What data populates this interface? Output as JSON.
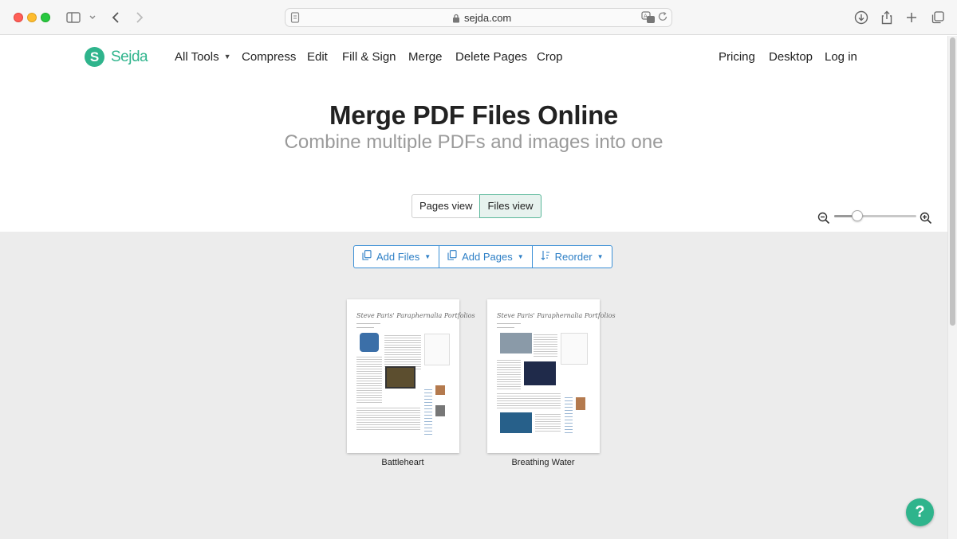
{
  "browser": {
    "url": "sejda.com",
    "icons": [
      "sidebar-icon",
      "chevron-down-icon",
      "back-icon",
      "forward-icon",
      "page-icon",
      "lock-icon",
      "translate-icon",
      "reload-icon",
      "download-icon",
      "share-icon",
      "new-tab-icon",
      "tabs-overview-icon"
    ]
  },
  "nav": {
    "logo_letter": "S",
    "logo_text": "Sejda",
    "left_links": [
      "All Tools",
      "Compress",
      "Edit",
      "Fill & Sign",
      "Merge",
      "Delete Pages",
      "Crop"
    ],
    "right_links": [
      "Pricing",
      "Desktop",
      "Log in"
    ]
  },
  "hero": {
    "title": "Merge PDF Files Online",
    "subtitle": "Combine multiple PDFs and images into one"
  },
  "view_toggle": {
    "options": [
      "Pages view",
      "Files view"
    ],
    "selected": "Files view"
  },
  "zoom": {
    "level": 0.25
  },
  "toolbar": {
    "add_files": "Add Files",
    "add_pages": "Add Pages",
    "reorder": "Reorder"
  },
  "files": [
    {
      "name": "Battleheart",
      "thumb_title": "Steve Paris' Paraphernalia Portfolios"
    },
    {
      "name": "Breathing Water",
      "thumb_title": "Steve Paris' Paraphernalia Portfolios"
    }
  ],
  "help": {
    "label": "?"
  },
  "colors": {
    "brand": "#2fb48c",
    "link_blue": "#2d7fc6",
    "workspace_bg": "#ececec"
  }
}
